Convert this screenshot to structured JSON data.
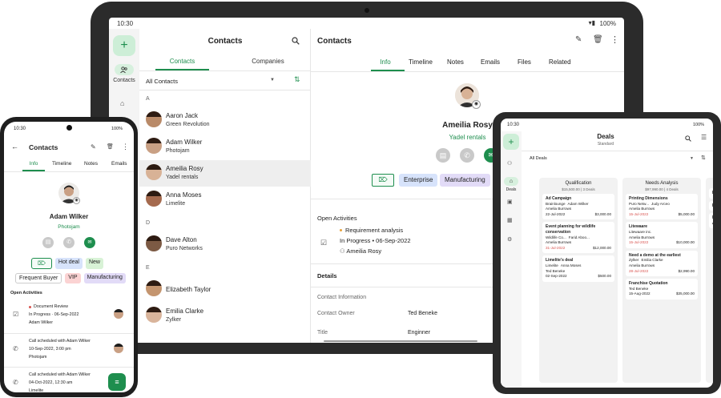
{
  "tablet": {
    "status": {
      "time": "10:30",
      "battery": "100%"
    },
    "rail": {
      "label": "Contacts"
    },
    "list": {
      "title": "Contacts",
      "tabs": [
        "Contacts",
        "Companies"
      ],
      "filter": "All Contacts",
      "sections": [
        {
          "letter": "A",
          "items": [
            {
              "name": "Aaron Jack",
              "company": "Green Revolution",
              "skin": "#b98a68"
            },
            {
              "name": "Adam Wilker",
              "company": "Photojam",
              "skin": "#c9a084"
            },
            {
              "name": "Ameilia Rosy",
              "company": "Yadel rentals",
              "skin": "#d8b296",
              "selected": true
            },
            {
              "name": "Anna Moses",
              "company": "Limelite",
              "skin": "#a56a4e"
            }
          ]
        },
        {
          "letter": "D",
          "items": [
            {
              "name": "Dave Alton",
              "company": "Puro Networks",
              "skin": "#7c5a44"
            }
          ]
        },
        {
          "letter": "E",
          "items": [
            {
              "name": "Elizabeth Taylor",
              "company": "",
              "skin": "#c4956f"
            },
            {
              "name": "Emilia Clarke",
              "company": "Zylker",
              "skin": "#d9b49b"
            }
          ]
        }
      ]
    },
    "detail": {
      "title": "Contacts",
      "tabs": [
        "Info",
        "Timeline",
        "Notes",
        "Emails",
        "Files",
        "Related"
      ],
      "name": "Ameilia Rosy",
      "company": "Yadel rentals",
      "tags": [
        "Enterprise",
        "Manufacturing"
      ],
      "open_activities_label": "Open Activities",
      "activity": {
        "title": "Requirement analysis",
        "status": "In Progress",
        "date": "06-Sep-2022",
        "owner": "Ameilia Rosy"
      },
      "details_label": "Details",
      "contact_info_label": "Contact Information",
      "fields": [
        {
          "label": "Contact Owner",
          "value": "Ted Beneke"
        },
        {
          "label": "Title",
          "value": "Enginner"
        }
      ]
    }
  },
  "phone": {
    "status": {
      "time": "10:30",
      "battery": "100%"
    },
    "title": "Contacts",
    "tabs": [
      "Info",
      "Timeline",
      "Notes",
      "Emails"
    ],
    "name": "Adam Wilker",
    "company": "Photojam",
    "tags": [
      {
        "label": "Hot deal",
        "bg": "#d7e3fb"
      },
      {
        "label": "New",
        "bg": "#d8f2d6"
      },
      {
        "label": "Frequent Buyer",
        "bg": "#ffffff"
      },
      {
        "label": "VIP",
        "bg": "#fbd3d3"
      },
      {
        "label": "Manufacturing",
        "bg": "#e2dbf7"
      }
    ],
    "open_activities_label": "Open Activities",
    "activities": [
      {
        "title": "Document Review",
        "line2": "In Progress · 06-Sep-2022",
        "line3": "Adam Wilker"
      },
      {
        "title": "Call scheduled with Adam Wilker",
        "line2": "10-Sep-2022, 3:00 pm",
        "line3": "Photojam"
      },
      {
        "title": "Call scheduled with Adam Wilker",
        "line2": "04-Oct-2022, 12:30 am",
        "line3": "Limelite"
      }
    ]
  },
  "fold": {
    "status": {
      "time": "10:30",
      "battery": "100%"
    },
    "title": "Deals",
    "subtitle": "Standard",
    "rail_label": "Deals",
    "filter": "All Deals",
    "columns": [
      {
        "name": "Qualification",
        "summary": "$15,500.00 | 3 Deals",
        "cards": [
          {
            "title": "Ad Campaign",
            "company": "Brainlounge",
            "contact": "Adam Wilker",
            "owner": "Amelia Burrows",
            "date": "22-Jul-2022",
            "amount": "$3,000.00",
            "overdue": false
          },
          {
            "title": "Event planning for wildlife conservation",
            "company": "Wildlife Co...",
            "contact": "Farid Aboo...",
            "owner": "Amelia Burrows",
            "date": "31-Jul-2022",
            "amount": "$12,000.00",
            "overdue": true
          },
          {
            "title": "Limelite's deal",
            "company": "Limelite",
            "contact": "Anna Moses",
            "owner": "Ted Beneke",
            "date": "02-Sep-2022",
            "amount": "$500.00",
            "overdue": false
          }
        ]
      },
      {
        "name": "Needs Analysis",
        "summary": "$97,990.00 | 4 Deals",
        "cards": [
          {
            "title": "Printing Dimensions",
            "company": "Puro Netw...",
            "contact": "Judy Arceo",
            "owner": "Amelia Burrows",
            "date": "15-Jul-2022",
            "amount": "$5,000.00",
            "overdue": true
          },
          {
            "title": "Litewaare",
            "company": "Litewaare inc.",
            "contact": "",
            "owner": "Amelia Burrows",
            "date": "15-Jul-2022",
            "amount": "$10,000.00",
            "overdue": true
          },
          {
            "title": "Need a demo at the earliest",
            "company": "Zylker",
            "contact": "Emilia Clarke",
            "owner": "Amelia Burrows",
            "date": "28-Jul-2022",
            "amount": "$2,990.00",
            "overdue": true
          },
          {
            "title": "Franchise Quotation",
            "company": "",
            "contact": "",
            "owner": "Ted Beneke",
            "date": "15-Aug-2022",
            "amount": "$35,000.00",
            "overdue": false
          }
        ]
      },
      {
        "name": "P",
        "summary": "",
        "cards": [
          {
            "title": "Rese",
            "company": "",
            "contact": "",
            "owner": "",
            "date": "",
            "amount": "",
            "overdue": false
          },
          {
            "title": "Hote",
            "company": "",
            "contact": "",
            "owner": "",
            "date": "",
            "amount": "",
            "overdue": false
          },
          {
            "title": "Mob Ama",
            "company": "",
            "contact": "",
            "owner": "",
            "date": "",
            "amount": "",
            "overdue": false
          }
        ]
      }
    ]
  },
  "colors": {
    "accent": "#1e8e4e",
    "fab": "#1e8e4e",
    "rail_active": "#d7f0de",
    "selected_row": "#eeeeee",
    "overdue": "#d9534f"
  }
}
